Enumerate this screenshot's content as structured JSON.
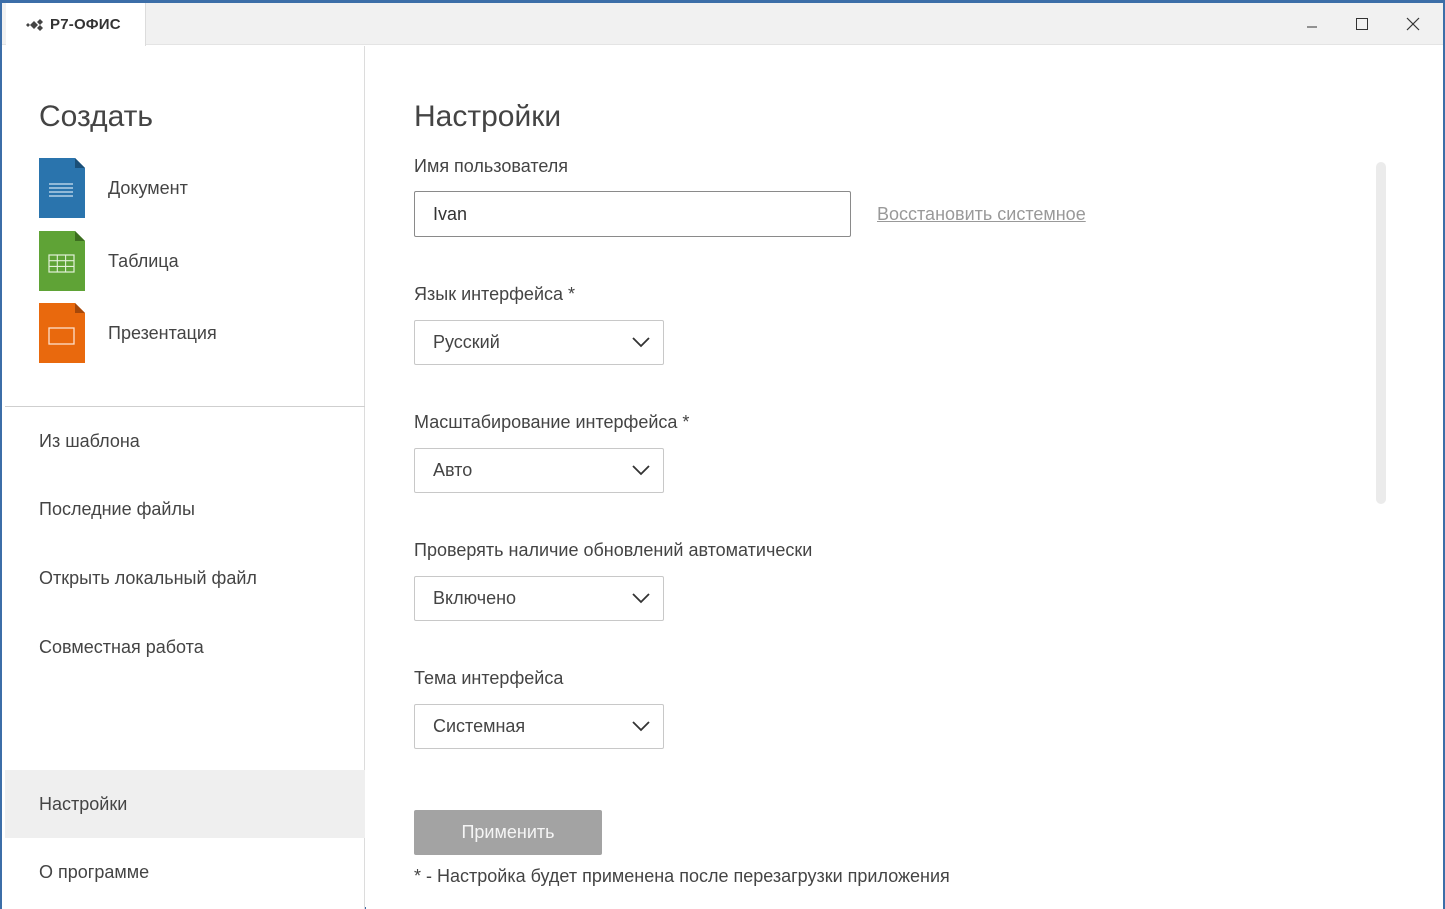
{
  "app": {
    "name": "Р7-ОФИС"
  },
  "window_controls": {
    "minimize_icon": "minimize-icon",
    "maximize_icon": "maximize-icon",
    "close_icon": "close-icon"
  },
  "sidebar": {
    "create_title": "Создать",
    "create_items": [
      {
        "label": "Документ",
        "icon": "document-icon",
        "color": "#2a74ad"
      },
      {
        "label": "Таблица",
        "icon": "spreadsheet-icon",
        "color": "#5fa336"
      },
      {
        "label": "Презентация",
        "icon": "presentation-icon",
        "color": "#e9690d"
      }
    ],
    "nav_items": [
      {
        "label": "Из шаблона"
      },
      {
        "label": "Последние файлы"
      },
      {
        "label": "Открыть локальный файл"
      },
      {
        "label": "Совместная работа"
      }
    ],
    "bottom_items": [
      {
        "label": "Настройки",
        "active": true
      },
      {
        "label": "О программе",
        "active": false
      }
    ]
  },
  "settings": {
    "title": "Настройки",
    "username": {
      "label": "Имя пользователя",
      "value": "Ivan",
      "restore_link": "Восстановить системное"
    },
    "language": {
      "label": "Язык интерфейса *",
      "value": "Русский"
    },
    "scaling": {
      "label": "Масштабирование интерфейса *",
      "value": "Авто"
    },
    "updates": {
      "label": "Проверять наличие обновлений автоматически",
      "value": "Включено"
    },
    "theme": {
      "label": "Тема интерфейса",
      "value": "Системная"
    },
    "apply_label": "Применить",
    "note": "* - Настройка будет применена после перезагрузки приложения"
  },
  "colors": {
    "window_border": "#3c6ea8",
    "active_nav_bg": "#efefef",
    "apply_button": "#a3a3a3"
  }
}
